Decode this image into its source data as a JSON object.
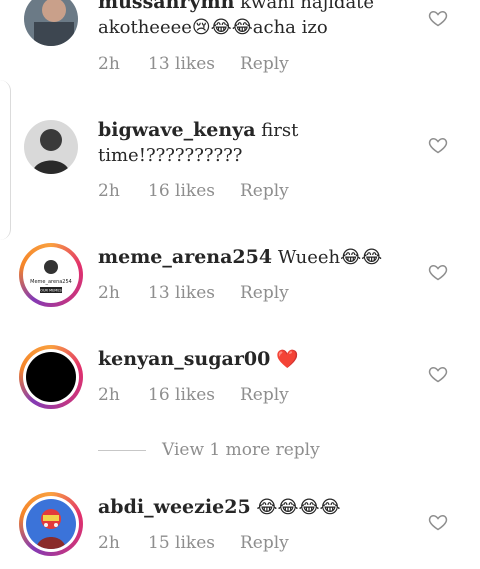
{
  "comments": [
    {
      "username": "mussahrymh",
      "text": "kwani hajidate akotheeee",
      "emoji": "😢😂😂",
      "text_after": "acha izo",
      "time": "2h",
      "likes": "13 likes",
      "reply": "Reply",
      "avatar_icon": "person-photo-avatar"
    },
    {
      "username": "bigwave_kenya",
      "text": "first time!??????????",
      "time": "2h",
      "likes": "16 likes",
      "reply": "Reply",
      "avatar_icon": "person-photo-avatar"
    },
    {
      "username": "meme_arena254",
      "text": "Wueeh",
      "emoji": "😂😂",
      "time": "2h",
      "likes": "13 likes",
      "reply": "Reply",
      "avatar_label_top": "Meme_arena254",
      "avatar_label_bottom": "OUR MEMES"
    },
    {
      "username": "kenyan_sugar00",
      "emoji": "❤️",
      "time": "2h",
      "likes": "16 likes",
      "reply": "Reply",
      "avatar_icon": "black-avatar"
    },
    {
      "username": "abdi_weezie25",
      "emoji": "😂😂😂😂",
      "time": "2h",
      "likes": "15 likes",
      "reply": "Reply",
      "avatar_icon": "cartoon-avatar"
    }
  ],
  "view_more": "View 1 more reply",
  "colors": {
    "text": "#262626",
    "meta": "#8e8e8e",
    "heart_outline": "#8e8e8e",
    "red_heart": "#e0245e",
    "story_ring": "#e1306c"
  }
}
